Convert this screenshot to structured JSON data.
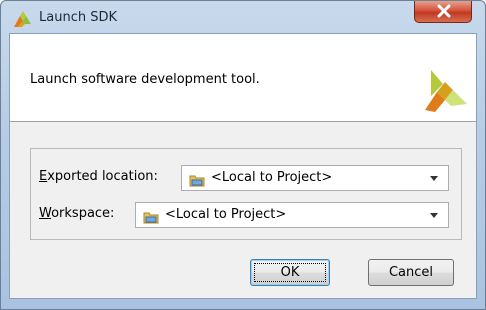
{
  "window": {
    "title": "Launch SDK",
    "close_glyph": "X"
  },
  "header": {
    "description": "Launch software development tool.",
    "logo": "xilinx-logo"
  },
  "form": {
    "exported_location": {
      "label_mnemonic": "E",
      "label_rest": "xported location:",
      "value": "<Local to Project>",
      "icon": "folder-icon"
    },
    "workspace": {
      "label_mnemonic": "W",
      "label_rest": "orkspace:",
      "value": "<Local to Project>",
      "icon": "folder-icon"
    }
  },
  "buttons": {
    "ok_label": "OK",
    "cancel_label": "Cancel"
  },
  "colors": {
    "title_bar": "#b7cde6",
    "close_button": "#c03a22",
    "client_bg": "#f0f0f0",
    "logo_orange": "#e07b1a",
    "logo_green": "#8bc03c"
  }
}
